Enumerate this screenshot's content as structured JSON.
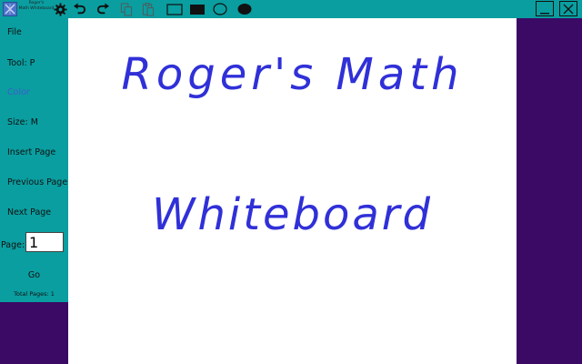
{
  "app": {
    "title_line1": "Roger's",
    "title_line2": "Math Whiteboard"
  },
  "toolbar": {
    "settings_icon": "gear-icon",
    "undo_icon": "undo-icon",
    "redo_icon": "redo-icon",
    "copy_icon": "copy-icon",
    "paste_icon": "paste-icon",
    "shapes": [
      "rectangle-outline",
      "rectangle-filled",
      "ellipse-outline",
      "ellipse-filled"
    ]
  },
  "window": {
    "minimize_icon": "minimize-icon",
    "close_icon": "close-icon"
  },
  "sidebar": {
    "file": "File",
    "tool": "Tool: P",
    "color": "Color",
    "size": "Size: M",
    "insert_page": "Insert Page",
    "previous_page": "Previous Page",
    "next_page": "Next Page",
    "page_label": "Page:",
    "page_value": "1",
    "go": "Go",
    "total_pages": "Total Pages: 1"
  },
  "canvas": {
    "line1": "Roger's Math",
    "line2": "Whiteboard",
    "ink_color": "#3030d8"
  },
  "colors": {
    "toolbar_bg": "#0a9ea0",
    "backdrop": "#3b0a64",
    "accent_color_text": "#3f5ccf"
  }
}
